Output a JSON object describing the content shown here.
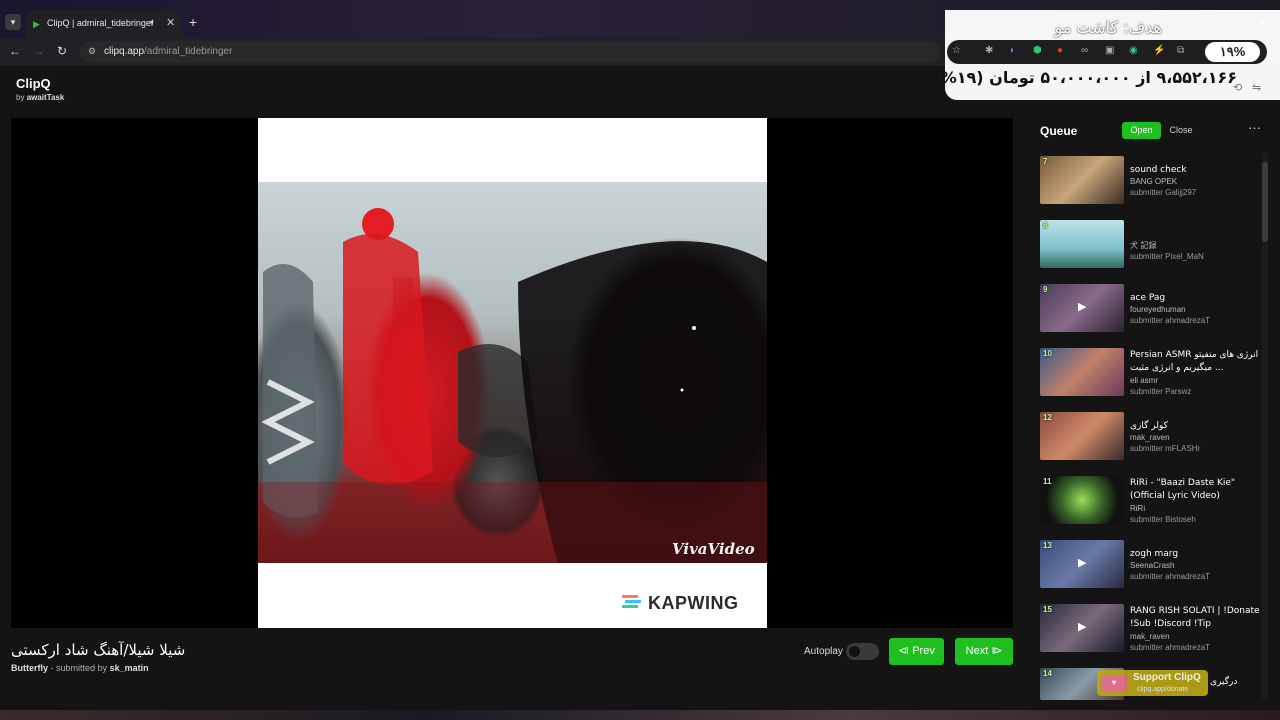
{
  "browser": {
    "tab_title": "ClipQ | admiral_tidebringer",
    "new_tab": "+",
    "url_domain": "clipq.app",
    "url_path": "/admiral_tidebringer"
  },
  "overlay": {
    "goal_text": "هدف: کاشت مو",
    "percent_pill": "۱۹%",
    "amount_text": "۹،۵۵۲،۱۶۶ از ۵۰،۰۰۰،۰۰۰ تومان (۱۹%)",
    "progress": 0.19
  },
  "brand": {
    "name": "ClipQ",
    "by_prefix": "by",
    "author": "awaitTask"
  },
  "player": {
    "watermark": "VivaVideo",
    "kapwing": "KAPWING",
    "title": "شیلا شیلا/آهنگ شاد ارکستی",
    "channel": "Butterfly",
    "meta_sep": "- submitted by",
    "submitter": "sk_matin",
    "autoplay_label": "Autoplay",
    "autoplay_on": false,
    "prev_label": "⧏ Prev",
    "next_label": "Next ⧐"
  },
  "queue": {
    "title": "Queue",
    "open_label": "Open",
    "close_label": "Close",
    "more": "···",
    "items": [
      {
        "num": "7",
        "title": "sound check",
        "channel": "BANG OPEK",
        "submitter": "submitter Galijj297"
      },
      {
        "num": "8",
        "title": "",
        "channel": "犬 記録",
        "submitter": "submitter Pixel_MaN"
      },
      {
        "num": "9",
        "title": "ace Pag",
        "channel": "foureyedhuman",
        "submitter": "submitter ahmadrezaT"
      },
      {
        "num": "10",
        "title": "Persian ASMR انرژی های منفیتو میگیریم و انرژی مثبت ...",
        "channel": "eli asmr",
        "submitter": "submitter Parswz"
      },
      {
        "num": "12",
        "title": "کولر گازی",
        "channel": "mak_raven",
        "submitter": "submitter mFLASHr"
      },
      {
        "num": "11",
        "title": "RiRi - \"Baazi Daste Kie\" (Official Lyric Video)",
        "channel": "RiRi",
        "submitter": "submitter Bistoseh"
      },
      {
        "num": "13",
        "title": "zogh marg",
        "channel": "SeenaCrash",
        "submitter": "submitter ahmadrezaT"
      },
      {
        "num": "15",
        "title": "RANG RISH SOLATI | !Donate !Sub !Discord !Tip",
        "channel": "mak_raven",
        "submitter": "submitter ahmadrezaT"
      },
      {
        "num": "14",
        "title": "درگیری",
        "channel": "",
        "submitter": ""
      }
    ]
  },
  "support": {
    "label": "Support ClipQ",
    "url": "clipq.app/donate"
  },
  "colors": {
    "accent_green": "#1fbf20",
    "background": "#141414"
  }
}
